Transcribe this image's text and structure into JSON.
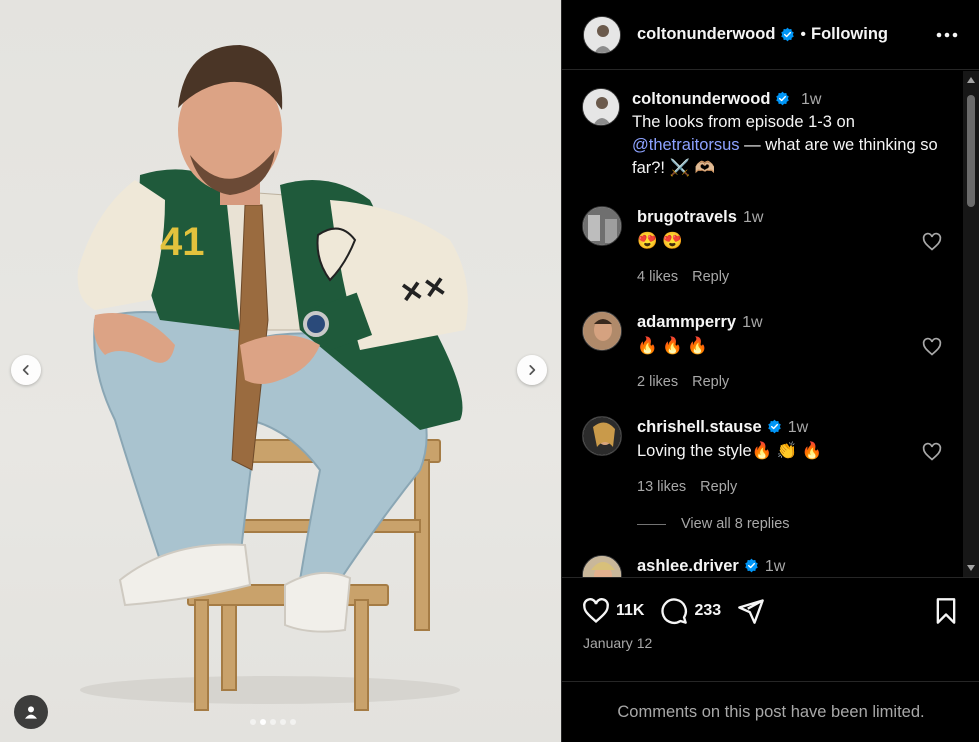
{
  "post": {
    "username": "coltonunderwood",
    "follow_status": "Following",
    "separator": "•",
    "caption_time": "1w",
    "caption_line1": "The looks from episode 1-3 on",
    "caption_mention": "@thetraitorsus",
    "caption_rest": " — what are we thinking so far?! ⚔️ 🫶🏼",
    "likes_count": "11K",
    "comments_count": "233",
    "date": "January 12",
    "comments_limited": "Comments on this post have been limited.",
    "carousel": {
      "total": 5,
      "active_index": 1
    }
  },
  "comments": [
    {
      "username": "brugotravels",
      "verified": false,
      "time": "1w",
      "text": "😍 😍",
      "likes": "4 likes",
      "reply": "Reply"
    },
    {
      "username": "adammperry",
      "verified": false,
      "time": "1w",
      "text": "🔥 🔥 🔥",
      "likes": "2 likes",
      "reply": "Reply"
    },
    {
      "username": "chrishell.stause",
      "verified": true,
      "time": "1w",
      "text": "Loving the style🔥 👏 🔥",
      "likes": "13 likes",
      "reply": "Reply"
    },
    {
      "username": "ashlee.driver",
      "verified": true,
      "time": "1w",
      "text": "",
      "likes": "",
      "reply": ""
    }
  ],
  "view_replies": "View all 8 replies",
  "colors": {
    "verified": "#0095f6",
    "mention": "#8da2ff",
    "secondary_text": "#a8a8a8"
  },
  "icons": [
    "chevron-left-icon",
    "chevron-right-icon",
    "user-tag-icon",
    "more-icon",
    "verified-icon",
    "heart-icon",
    "comment-icon",
    "share-icon",
    "bookmark-icon"
  ]
}
